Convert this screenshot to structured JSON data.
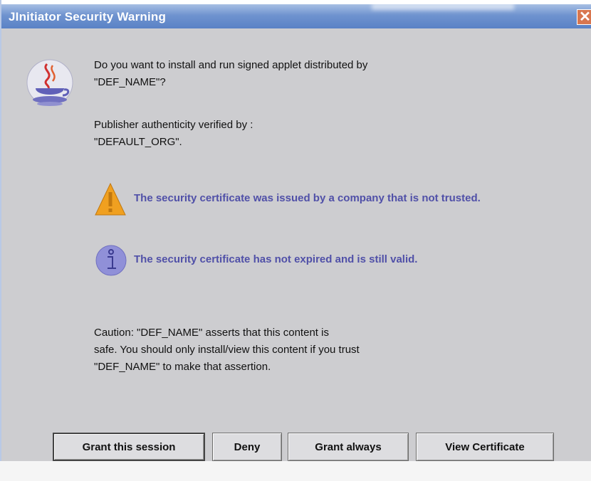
{
  "window": {
    "title": "JInitiator Security Warning",
    "close_glyph": "✕"
  },
  "message": {
    "line1": "Do you want to install and run signed applet distributed by",
    "line2": "\"DEF_NAME\"?",
    "publisher_line1": "Publisher authenticity verified by :",
    "publisher_line2": "\"DEFAULT_ORG\"."
  },
  "notices": [
    {
      "icon": "warning-triangle-icon",
      "text": "The security certificate was issued by a company that is not trusted."
    },
    {
      "icon": "info-icon",
      "text": "The security certificate has not expired and is still valid."
    }
  ],
  "caution": {
    "line1": "Caution: \"DEF_NAME\" asserts that this content is",
    "line2": "safe. You should only install/view this content if you trust",
    "line3": "\"DEF_NAME\" to make that assertion."
  },
  "buttons": {
    "grant_session": "Grant this session",
    "deny": "Deny",
    "grant_always": "Grant always",
    "view_certificate": "View Certificate"
  },
  "colors": {
    "title_bar": "#5a82c6",
    "dialog_bg": "#cdcdd0",
    "notice_text": "#5050a8",
    "warning_icon": "#f0a020",
    "info_icon": "#8f8fd8"
  }
}
